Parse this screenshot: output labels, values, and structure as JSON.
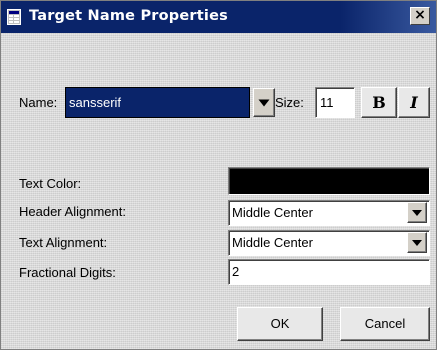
{
  "window": {
    "title": "Target Name Properties",
    "close_glyph": "×",
    "title_icon": "properties-window-icon"
  },
  "font_row": {
    "name_label": "Name:",
    "name_value": "sansserif",
    "size_label": "Size:",
    "size_value": "11",
    "bold_label": "B",
    "italic_label": "I"
  },
  "properties": {
    "text_color_label": "Text Color:",
    "text_color_value": "#000000",
    "header_alignment_label": "Header Alignment:",
    "header_alignment_value": "Middle Center",
    "text_alignment_label": "Text Alignment:",
    "text_alignment_value": "Middle Center",
    "fractional_digits_label": "Fractional Digits:",
    "fractional_digits_value": "2"
  },
  "buttons": {
    "ok_label": "OK",
    "cancel_label": "Cancel"
  },
  "colors": {
    "title_bar": "#0a246a",
    "selection": "#0a246a"
  }
}
